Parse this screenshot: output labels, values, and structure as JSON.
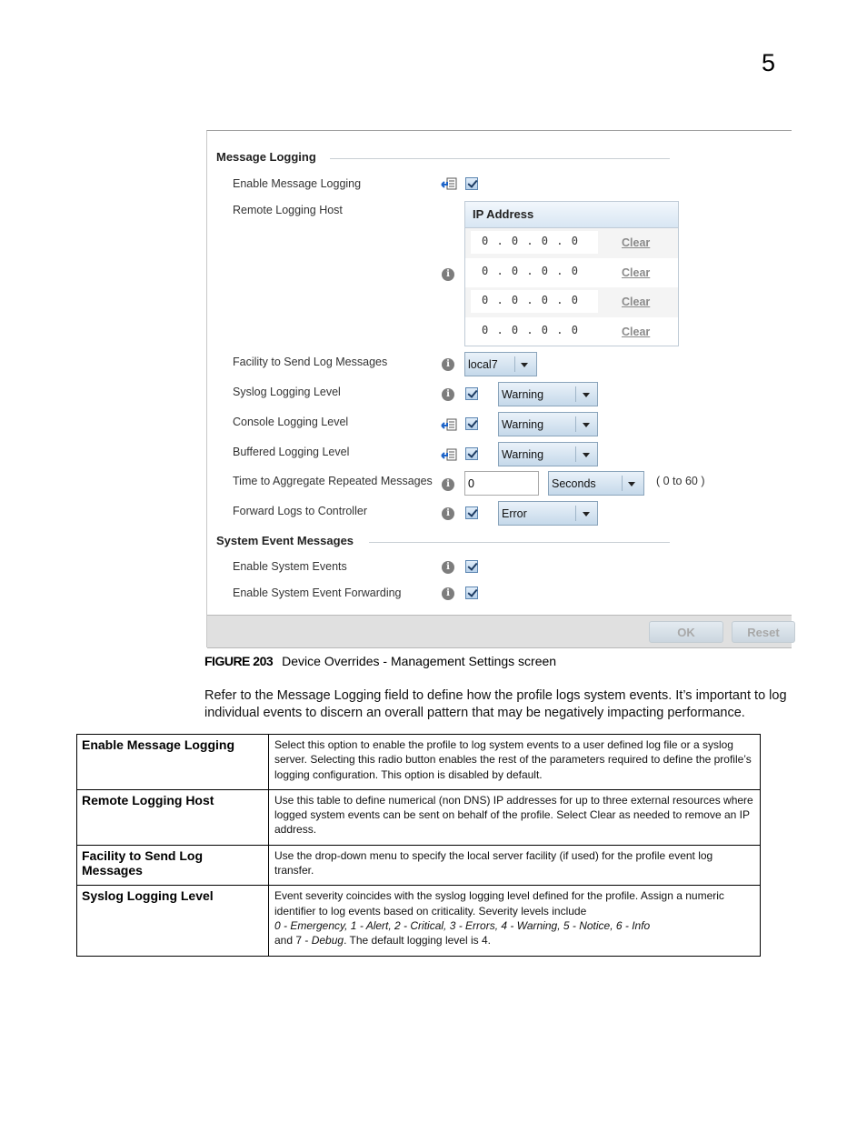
{
  "page": {
    "chapter_number": "5"
  },
  "screen": {
    "message_logging": {
      "section_title": "Message Logging",
      "enable_message_logging": {
        "label": "Enable Message Logging",
        "icon": "override-icon",
        "checked": true
      },
      "remote_logging_host": {
        "label": "Remote Logging Host",
        "icon": "info-icon",
        "table_header": "IP Address",
        "rows": [
          {
            "ip": "0 . 0 . 0 . 0",
            "action": "Clear"
          },
          {
            "ip": "0 . 0 . 0 . 0",
            "action": "Clear"
          },
          {
            "ip": "0 . 0 . 0 . 0",
            "action": "Clear"
          },
          {
            "ip": "0 . 0 . 0 . 0",
            "action": "Clear"
          }
        ]
      },
      "facility": {
        "label": "Facility to Send Log Messages",
        "icon": "info-icon",
        "value": "local7"
      },
      "syslog_level": {
        "label": "Syslog Logging Level",
        "icon": "info-icon",
        "checked": true,
        "value": "Warning"
      },
      "console_level": {
        "label": "Console Logging Level",
        "icon": "override-icon",
        "checked": true,
        "value": "Warning"
      },
      "buffered_level": {
        "label": "Buffered Logging Level",
        "icon": "override-icon",
        "checked": true,
        "value": "Warning"
      },
      "aggregate_time": {
        "label": "Time to Aggregate Repeated Messages",
        "icon": "info-icon",
        "value": "0",
        "unit": "Seconds",
        "range": "( 0 to 60 )"
      },
      "forward_logs": {
        "label": "Forward Logs to Controller",
        "icon": "info-icon",
        "checked": true,
        "value": "Error"
      }
    },
    "system_events": {
      "section_title": "System Event Messages",
      "enable_system_events": {
        "label": "Enable System Events",
        "icon": "info-icon",
        "checked": true
      },
      "enable_event_forwarding": {
        "label": "Enable System Event Forwarding",
        "icon": "info-icon",
        "checked": true
      }
    },
    "footer": {
      "ok_label": "OK",
      "reset_label": "Reset"
    }
  },
  "caption": {
    "figure": "FIGURE 203",
    "text": "Device Overrides - Management Settings screen"
  },
  "intro_paragraph": "Refer to the Message Logging field to define how the profile logs system events. It’s important to log individual events to discern an overall pattern that may be negatively impacting performance.",
  "description_table": [
    {
      "term": "Enable Message Logging",
      "definition": "Select this option to enable the profile to log system events to a user defined log file or a syslog server. Selecting this radio button enables the rest of the parameters required to define the profile’s logging configuration. This option is disabled by default."
    },
    {
      "term": "Remote Logging Host",
      "definition": "Use this table to define numerical (non DNS) IP addresses for up to three external resources where logged system events can be sent on behalf of the profile. Select Clear as needed to remove an IP address."
    },
    {
      "term": "Facility to Send Log Messages",
      "definition": "Use the drop-down menu to specify the local server facility (if used) for the profile event log transfer."
    },
    {
      "term": "Syslog Logging Level",
      "definition_intro": "Event severity coincides with the syslog logging level defined for the profile. Assign a numeric identifier to log events based on criticality. Severity levels include",
      "definition_levels": "0 - Emergency, 1 - Alert, 2 - Critical, 3 - Errors, 4 - Warning, 5 - Notice, 6 - Info",
      "definition_and": "and 7 - ",
      "definition_debug": "Debug",
      "definition_end": ". The default logging level is 4."
    }
  ]
}
